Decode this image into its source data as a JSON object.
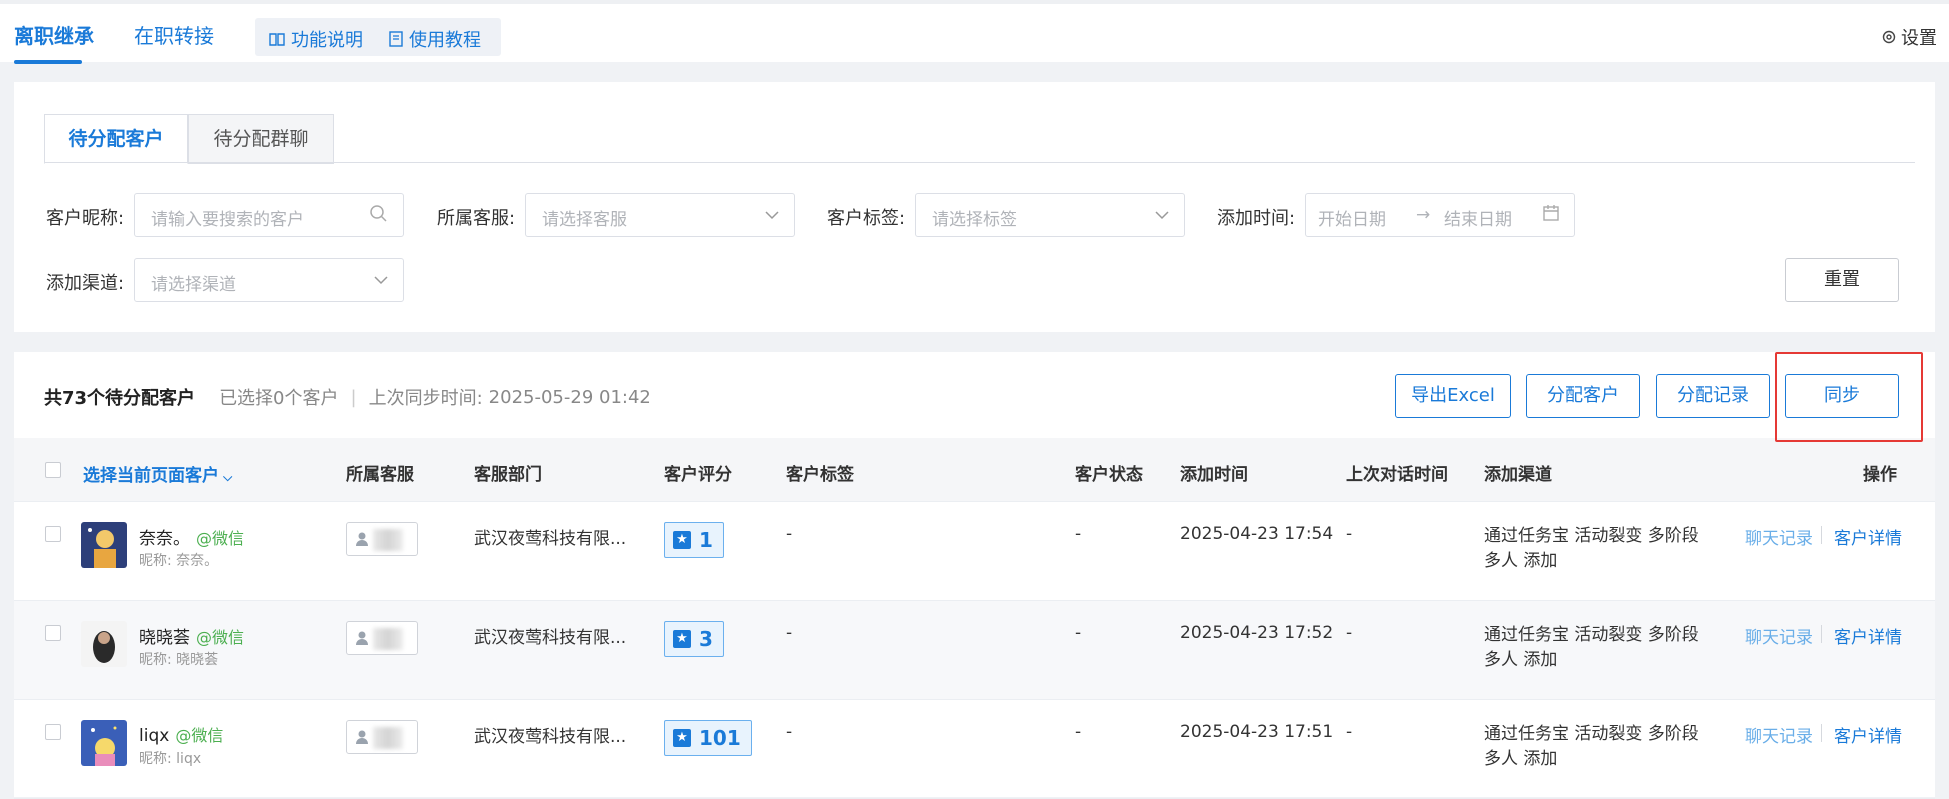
{
  "top_tabs": [
    {
      "label": "离职继承",
      "active": true
    },
    {
      "label": "在职转接",
      "active": false
    }
  ],
  "help_links": [
    {
      "label": "功能说明",
      "icon": "book-icon"
    },
    {
      "label": "使用教程",
      "icon": "document-icon"
    }
  ],
  "settings_label": "设置",
  "sub_tabs": [
    {
      "label": "待分配客户",
      "active": true
    },
    {
      "label": "待分配群聊",
      "active": false
    }
  ],
  "filters": {
    "customer_nickname": {
      "label": "客户昵称:",
      "placeholder": "请输入要搜索的客户"
    },
    "agent": {
      "label": "所属客服:",
      "placeholder": "请选择客服"
    },
    "tags": {
      "label": "客户标签:",
      "placeholder": "请选择标签"
    },
    "add_time": {
      "label": "添加时间:",
      "start_placeholder": "开始日期",
      "arrow": "→",
      "end_placeholder": "结束日期"
    },
    "channel": {
      "label": "添加渠道:",
      "placeholder": "请选择渠道"
    },
    "reset_label": "重置"
  },
  "summary": {
    "count_text": "共73个待分配客户",
    "selected_text": "已选择0个客户",
    "sync_text": "上次同步时间:",
    "sync_time": "2025-05-29 01:42"
  },
  "actions": {
    "export": "导出Excel",
    "assign": "分配客户",
    "assign_records": "分配记录",
    "sync": "同步"
  },
  "columns": {
    "select_page": "选择当前页面客户",
    "agent": "所属客服",
    "department": "客服部门",
    "score": "客户评分",
    "tags": "客户标签",
    "status": "客户状态",
    "add_time": "添加时间",
    "last_chat": "上次对话时间",
    "channel": "添加渠道",
    "ops": "操作"
  },
  "rows": [
    {
      "name": "奈奈。",
      "source": "@微信",
      "nickname": "昵称: 奈奈。",
      "department": "武汉夜莺科技有限...",
      "score": "1",
      "tags": "-",
      "status": "-",
      "add_time": "2025-04-23 17:54",
      "last_chat": "-",
      "channel": "通过任务宝 活动裂变 多阶段多人 添加",
      "op_chat": "聊天记录",
      "op_detail": "客户详情"
    },
    {
      "name": "晓晓荟",
      "source": "@微信",
      "nickname": "昵称: 晓晓荟",
      "department": "武汉夜莺科技有限...",
      "score": "3",
      "tags": "-",
      "status": "-",
      "add_time": "2025-04-23 17:52",
      "last_chat": "-",
      "channel": "通过任务宝 活动裂变 多阶段多人 添加",
      "op_chat": "聊天记录",
      "op_detail": "客户详情"
    },
    {
      "name": "liqx",
      "source": "@微信",
      "nickname": "昵称: liqx",
      "department": "武汉夜莺科技有限...",
      "score": "101",
      "tags": "-",
      "status": "-",
      "add_time": "2025-04-23 17:51",
      "last_chat": "-",
      "channel": "通过任务宝 活动裂变 多阶段多人 添加",
      "op_chat": "聊天记录",
      "op_detail": "客户详情"
    }
  ],
  "colors": {
    "accent": "#1a7ad8",
    "wechat": "#4caf50",
    "highlight": "#e53935"
  }
}
